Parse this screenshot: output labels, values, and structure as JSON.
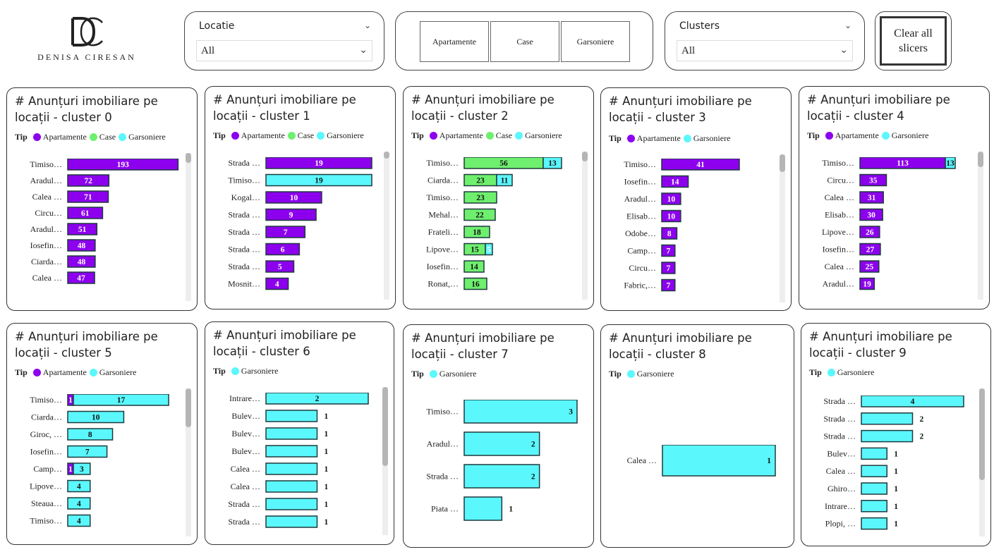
{
  "logo": {
    "brand": "DENISA CIRESAN",
    "icon": "dc-monogram-icon"
  },
  "slicers": {
    "locatie": {
      "title": "Locatie",
      "value": "All"
    },
    "clusters": {
      "title": "Clusters",
      "value": "All"
    }
  },
  "tiles": [
    "Apartamente",
    "Case",
    "Garsoniere"
  ],
  "clear_button": {
    "line1": "Clear all",
    "line2": "slicers"
  },
  "colors": {
    "Apartamente": "#8c00ee",
    "Case": "#6ef06e",
    "Garsoniere": "#5af7fd"
  },
  "chart_data": [
    {
      "type": "bar",
      "title_line1": "# Anunțuri imobiliare pe",
      "title_line2": "locații - cluster 0",
      "legend_title": "Tip",
      "legend": [
        "Apartamente",
        "Case",
        "Garsoniere"
      ],
      "categories": [
        "Timiso…",
        "Aradul…",
        "Calea …",
        "Circu…",
        "Aradul…",
        "Iosefin…",
        "Ciarda…",
        "Calea …"
      ],
      "series": [
        {
          "name": "Apartamente",
          "values": [
            193,
            72,
            71,
            61,
            51,
            48,
            48,
            47
          ]
        }
      ]
    },
    {
      "type": "bar",
      "title_line1": "# Anunțuri imobiliare pe",
      "title_line2": "locații - cluster 1",
      "legend_title": "Tip",
      "legend": [
        "Apartamente",
        "Case",
        "Garsoniere"
      ],
      "categories": [
        "Strada …",
        "Timiso…",
        "Kogal…",
        "Strada …",
        "Strada …",
        "Strada …",
        "Strada …",
        "Mosnit…"
      ],
      "series": [
        {
          "name": "Apartamente",
          "values": [
            19,
            0,
            10,
            9,
            7,
            6,
            5,
            4
          ]
        },
        {
          "name": "Garsoniere",
          "values": [
            0,
            19,
            0,
            0,
            0,
            0,
            0,
            0
          ]
        }
      ]
    },
    {
      "type": "bar",
      "title_line1": "# Anunțuri imobiliare pe",
      "title_line2": "locații - cluster 2",
      "legend_title": "Tip",
      "legend": [
        "Apartamente",
        "Case",
        "Garsoniere"
      ],
      "categories": [
        "Timiso…",
        "Ciarda…",
        "Timiso…",
        "Mehal…",
        "Frateli…",
        "Lipove…",
        "Iosefin…",
        "Ronat,…"
      ],
      "series": [
        {
          "name": "Case",
          "values": [
            56,
            23,
            23,
            22,
            18,
            15,
            14,
            16
          ]
        },
        {
          "name": "Garsoniere",
          "values": [
            13,
            11,
            0,
            0,
            0,
            5,
            0,
            0
          ]
        }
      ]
    },
    {
      "type": "bar",
      "title_line1": "# Anunțuri imobiliare pe",
      "title_line2": "locații - cluster 3",
      "legend_title": "Tip",
      "legend": [
        "Apartamente",
        "Garsoniere"
      ],
      "categories": [
        "Timiso…",
        "Iosefin…",
        "Aradul…",
        "Elisab…",
        "Odobe…",
        "Camp…",
        "Circu…",
        "Fabric,…"
      ],
      "series": [
        {
          "name": "Apartamente",
          "values": [
            41,
            14,
            10,
            10,
            8,
            7,
            7,
            7
          ]
        }
      ]
    },
    {
      "type": "bar",
      "title_line1": "# Anunțuri imobiliare pe",
      "title_line2": "locații - cluster 4",
      "legend_title": "Tip",
      "legend": [
        "Apartamente",
        "Garsoniere"
      ],
      "categories": [
        "Timiso…",
        "Circu…",
        "Calea …",
        "Elisab…",
        "Lipove…",
        "Iosefin…",
        "Calea …",
        "Aradul…"
      ],
      "series": [
        {
          "name": "Apartamente",
          "values": [
            113,
            35,
            31,
            30,
            26,
            27,
            25,
            19
          ]
        },
        {
          "name": "Garsoniere",
          "values": [
            13,
            0,
            0,
            0,
            0,
            0,
            0,
            0
          ]
        }
      ]
    },
    {
      "type": "bar",
      "title_line1": "# Anunțuri imobiliare pe",
      "title_line2": "locații - cluster 5",
      "legend_title": "Tip",
      "legend": [
        "Apartamente",
        "Garsoniere"
      ],
      "categories": [
        "Timiso…",
        "Ciarda…",
        "Giroc, …",
        "Iosefin…",
        "Camp…",
        "Lipove…",
        "Steaua…",
        "Timiso…"
      ],
      "series": [
        {
          "name": "Apartamente",
          "values": [
            1,
            0,
            0,
            0,
            1,
            0,
            0,
            0
          ]
        },
        {
          "name": "Garsoniere",
          "values": [
            17,
            10,
            8,
            7,
            3,
            4,
            4,
            4
          ]
        }
      ]
    },
    {
      "type": "bar",
      "title_line1": "# Anunțuri imobiliare pe",
      "title_line2": "locații - cluster 6",
      "legend_title": "Tip",
      "legend": [
        "Garsoniere"
      ],
      "categories": [
        "Intrare…",
        "Bulev…",
        "Bulev…",
        "Bulev…",
        "Calea …",
        "Calea …",
        "Strada …",
        "Strada …"
      ],
      "series": [
        {
          "name": "Garsoniere",
          "values": [
            2,
            1,
            1,
            1,
            1,
            1,
            1,
            1
          ]
        }
      ]
    },
    {
      "type": "bar",
      "title_line1": "# Anunțuri imobiliare pe",
      "title_line2": "locații - cluster 7",
      "legend_title": "Tip",
      "legend": [
        "Garsoniere"
      ],
      "categories": [
        "Timiso…",
        "Aradul…",
        "Strada …",
        "Piata …"
      ],
      "series": [
        {
          "name": "Garsoniere",
          "values": [
            3,
            2,
            2,
            1
          ]
        }
      ]
    },
    {
      "type": "bar",
      "title_line1": "# Anunțuri imobiliare pe",
      "title_line2": "locații - cluster 8",
      "legend_title": "Tip",
      "legend": [
        "Garsoniere"
      ],
      "categories": [
        "Calea …"
      ],
      "series": [
        {
          "name": "Garsoniere",
          "values": [
            1
          ]
        }
      ]
    },
    {
      "type": "bar",
      "title_line1": "# Anunțuri imobiliare pe",
      "title_line2": "locații - cluster 9",
      "legend_title": "Tip",
      "legend": [
        "Garsoniere"
      ],
      "categories": [
        "Strada …",
        "Strada …",
        "Strada …",
        "Bulev…",
        "Calea …",
        "Ghiro…",
        "Intrare…",
        "Plopi, …"
      ],
      "series": [
        {
          "name": "Garsoniere",
          "values": [
            4,
            2,
            2,
            1,
            1,
            1,
            1,
            1
          ]
        }
      ]
    }
  ]
}
